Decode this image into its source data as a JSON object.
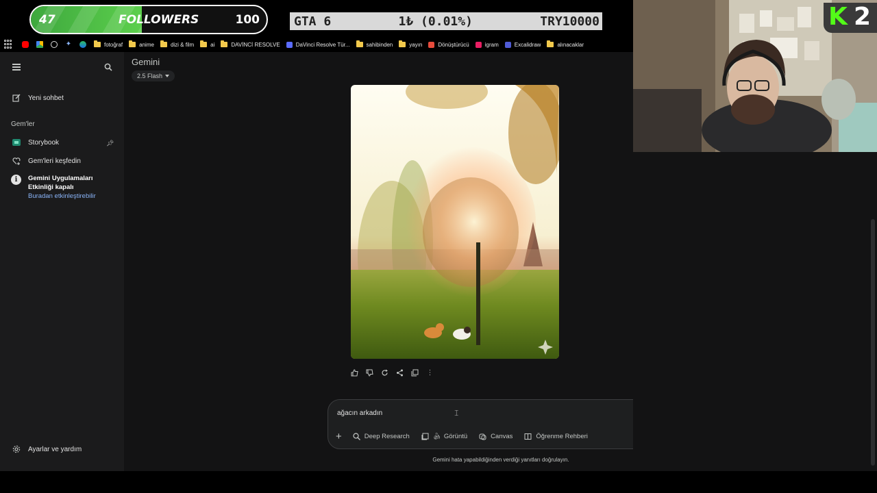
{
  "overlay": {
    "followers_current": "47",
    "followers_label": "FOLLOWERS",
    "followers_goal": "100",
    "followers_progress": 0.47,
    "ticker_title": "GTA 6",
    "ticker_amount": "1₺ (0.01%)",
    "ticker_goal": "TRY10000"
  },
  "bookmarks": [
    {
      "label": "fotoğraf",
      "type": "folder"
    },
    {
      "label": "anime",
      "type": "folder"
    },
    {
      "label": "dizi & film",
      "type": "folder"
    },
    {
      "label": "ai",
      "type": "folder"
    },
    {
      "label": "DAVİNCİ RESOLVE",
      "type": "folder"
    },
    {
      "label": "DaVinci Resolve Tür...",
      "type": "site"
    },
    {
      "label": "sahibinden",
      "type": "folder"
    },
    {
      "label": "yayın",
      "type": "folder"
    },
    {
      "label": "Dönüştürücü",
      "type": "site"
    },
    {
      "label": "igram",
      "type": "site"
    },
    {
      "label": "Excalidraw",
      "type": "site"
    },
    {
      "label": "alınacaklar",
      "type": "folder"
    }
  ],
  "sidebar": {
    "new_chat": "Yeni sohbet",
    "gems_heading": "Gem'ler",
    "storybook": "Storybook",
    "explore_gems": "Gem'leri keşfedin",
    "activity_title": "Gemini Uygulamaları Etkinliği kapalı",
    "activity_link": "Buradan etkinleştirebilir",
    "settings": "Ayarlar ve yardım"
  },
  "main": {
    "title": "Gemini",
    "model": "2.5 Flash",
    "prompt_value": "ağacın arkadın",
    "tools": {
      "deep_research": "Deep Research",
      "image": "Görüntü",
      "canvas": "Canvas",
      "learning": "Öğrenme Rehberi"
    },
    "disclaimer": "Gemini hata yapabildiğinden verdiği yanıtları doğrulayın."
  },
  "colors": {
    "accent_green": "#53fc18",
    "link_blue": "#8ab4f8",
    "sidebar_bg": "#1b1b1c",
    "main_bg": "#131314"
  }
}
